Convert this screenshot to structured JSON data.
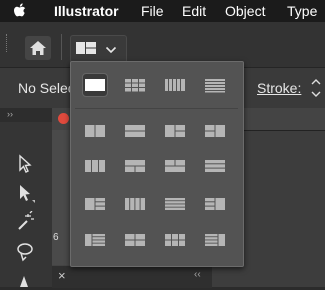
{
  "menubar": {
    "app": "Illustrator",
    "file": "File",
    "edit": "Edit",
    "object": "Object",
    "type": "Type"
  },
  "control": {
    "no_selection": "No Selec",
    "stroke": "Stroke:"
  },
  "ruler": {
    "mark": "6"
  },
  "panel": {
    "close": "×",
    "collapse": "‹‹"
  },
  "leftpanel": {
    "collapse": "››"
  },
  "colors": {
    "menubar": "#1b1b1b",
    "panel": "#535353",
    "icon": "#b5b5b5",
    "selected_icon": "#ffffff"
  }
}
